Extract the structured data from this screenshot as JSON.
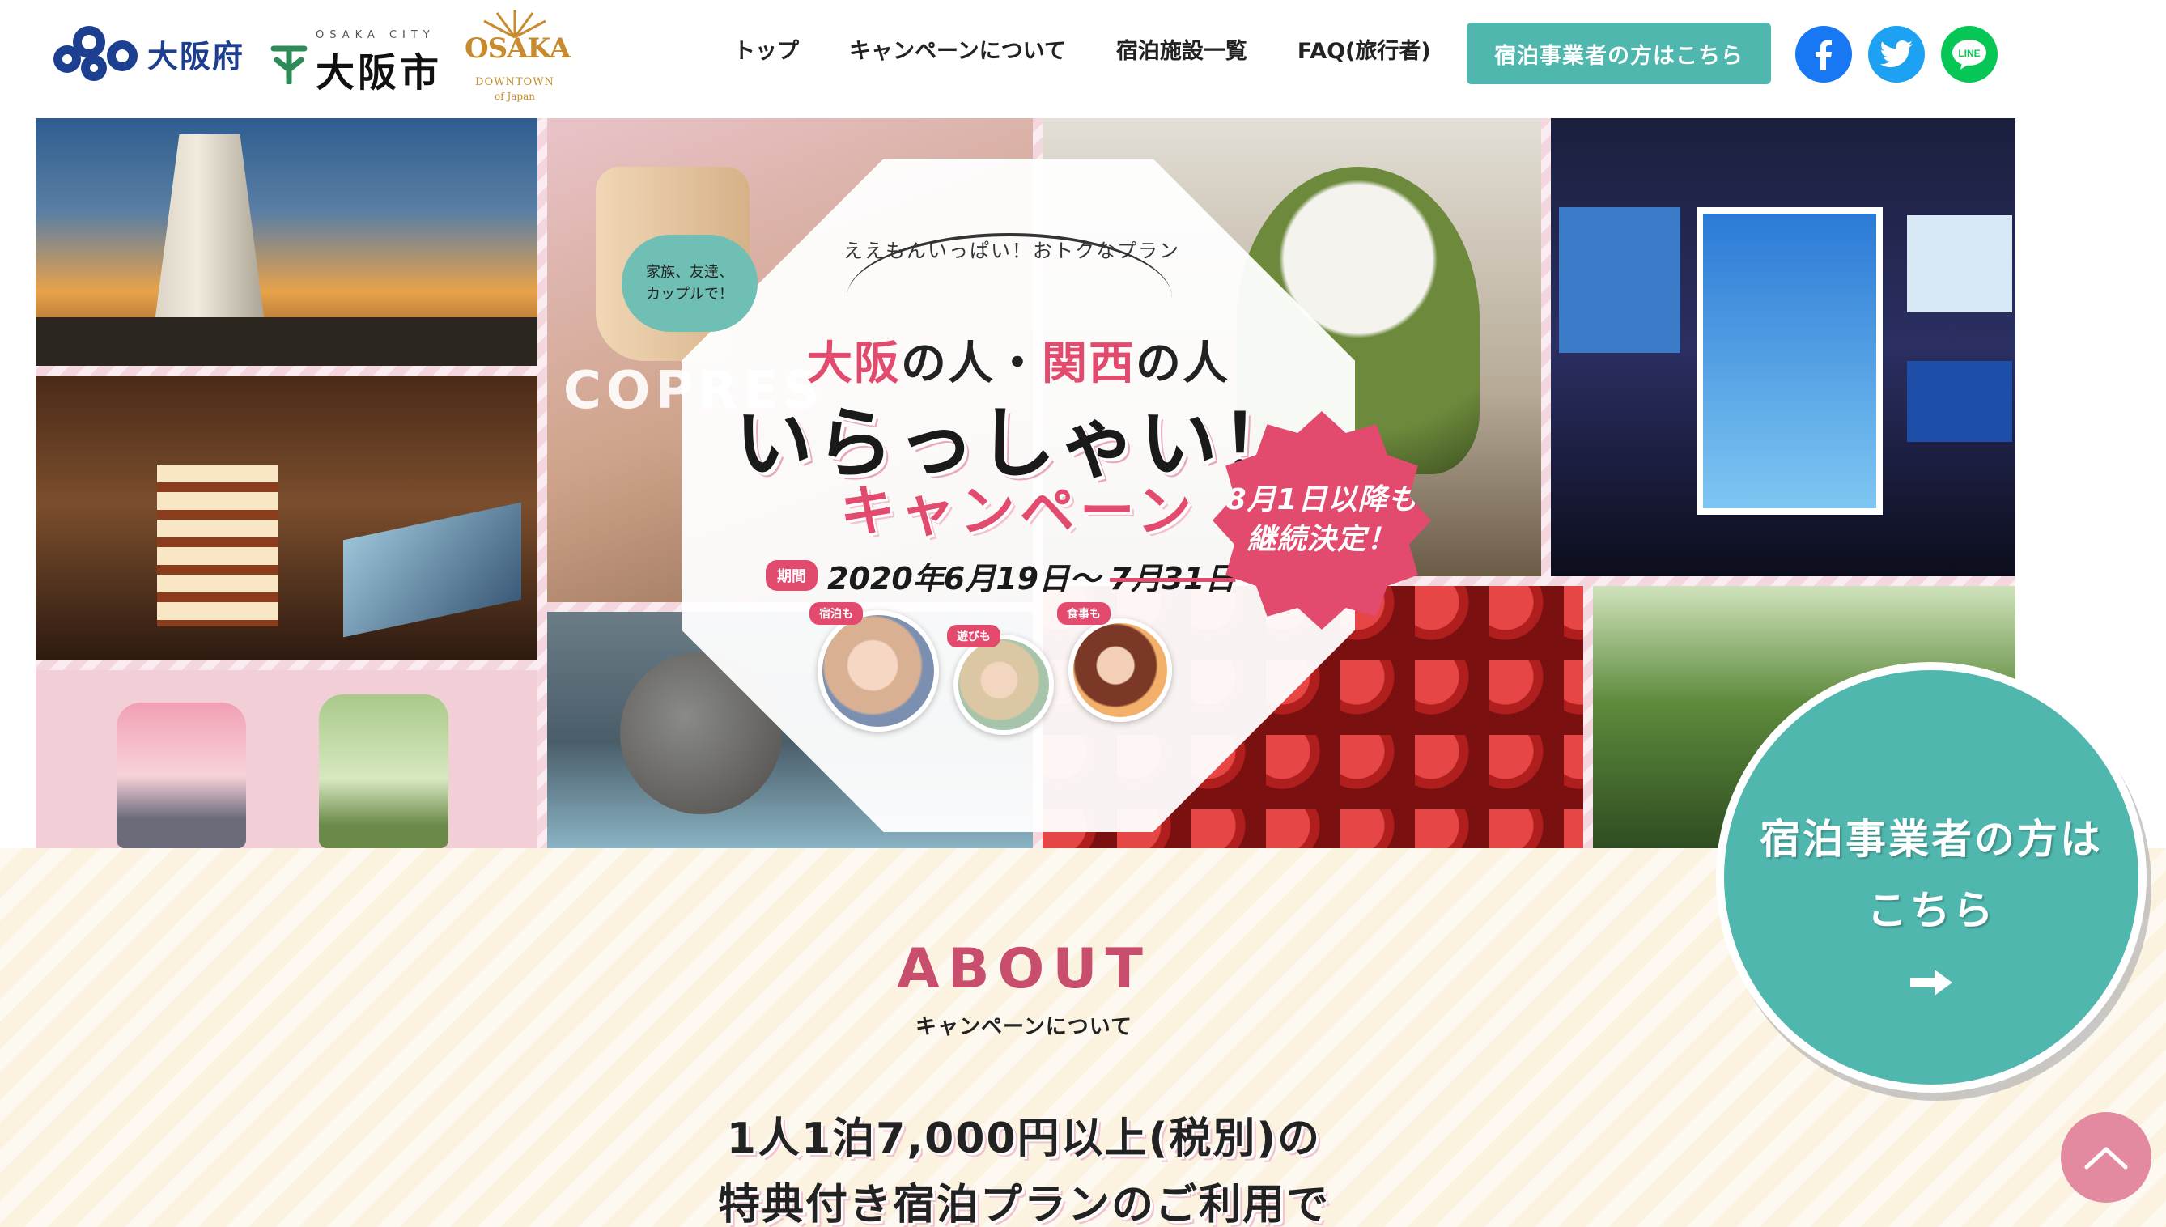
{
  "header": {
    "pref_logo": {
      "name": "大阪府",
      "icon": "osaka-prefecture-mark"
    },
    "city_logo": {
      "name": "大阪市",
      "sub": "OSAKA CITY",
      "icon": "osaka-city-mark"
    },
    "downtown_logo": {
      "title": "OSAKA",
      "sub": "DOWNTOWN",
      "sub2": "of Japan"
    },
    "nav": [
      {
        "label": "トップ"
      },
      {
        "label": "キャンペーンについて"
      },
      {
        "label": "宿泊施設一覧"
      },
      {
        "label": "FAQ(旅行者)"
      }
    ],
    "cta_label": "宿泊事業者の方はこちら",
    "sns": [
      {
        "name": "facebook-icon",
        "color": "#1877f2"
      },
      {
        "name": "twitter-icon",
        "color": "#1da1f2"
      },
      {
        "name": "line-icon",
        "label": "LINE",
        "color": "#06c755"
      }
    ]
  },
  "hero": {
    "tagline": "ええもんいっぱい！おトクなプラン",
    "bubble": "家族、友達、カップルで！",
    "line1_a": "大阪",
    "line1_b": "の人・",
    "line1_c": "関西",
    "line1_d": "の人",
    "line2": "いらっしゃい！",
    "line3": "キャンペーン",
    "period_tag": "期間",
    "period_start": "2020年6月19日～",
    "period_end": "7月31日",
    "circle_tags": [
      "宿泊も",
      "遊びも",
      "食事も"
    ],
    "burst_line1": "8月1日以降も",
    "burst_line2": "継続決定！",
    "coffee_sign": "COPRES",
    "accent": "#e24a6e"
  },
  "about": {
    "title": "ABOUT",
    "subtitle": "キャンペーンについて",
    "line1": "1人1泊7,000円以上(税別)の",
    "line2": "特典付き宿泊プランのご利用で"
  },
  "floating": {
    "cta_line1": "宿泊事業者の方は",
    "cta_line2": "こちら",
    "cta_color": "#4fb7ae",
    "to_top_color": "#e48aa0"
  }
}
